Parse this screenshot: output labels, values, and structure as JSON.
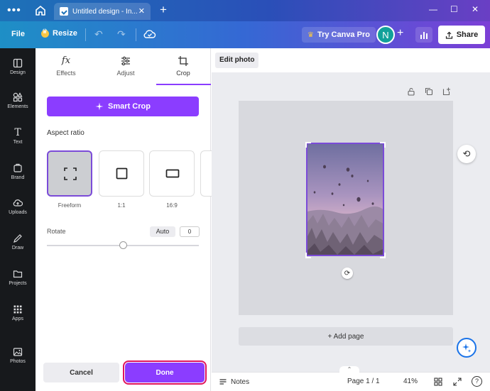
{
  "titlebar": {
    "tab_title": "Untitled design - In...",
    "menu_icon": "more-dots-icon",
    "home_icon": "home-icon",
    "new_tab_icon": "plus-icon"
  },
  "toolbar": {
    "file_label": "File",
    "resize_label": "Resize",
    "try_canva_label": "Try Canva Pro",
    "avatar_initial": "N",
    "share_label": "Share"
  },
  "rail": {
    "items": [
      {
        "label": "Design",
        "icon": "design-icon"
      },
      {
        "label": "Elements",
        "icon": "elements-icon"
      },
      {
        "label": "Text",
        "icon": "text-icon"
      },
      {
        "label": "Brand",
        "icon": "brand-icon"
      },
      {
        "label": "Uploads",
        "icon": "uploads-icon"
      },
      {
        "label": "Draw",
        "icon": "draw-icon"
      },
      {
        "label": "Projects",
        "icon": "projects-icon"
      },
      {
        "label": "Apps",
        "icon": "apps-icon"
      },
      {
        "label": "Photos",
        "icon": "photos-icon"
      }
    ]
  },
  "panel": {
    "tabs": [
      {
        "label": "Effects",
        "icon": "fx-icon"
      },
      {
        "label": "Adjust",
        "icon": "sliders-icon"
      },
      {
        "label": "Crop",
        "icon": "crop-icon"
      }
    ],
    "active_tab": "Crop",
    "smart_crop_label": "Smart Crop",
    "aspect_ratio_label": "Aspect ratio",
    "ratios": [
      {
        "label": "Freeform",
        "selected": true
      },
      {
        "label": "1:1",
        "selected": false
      },
      {
        "label": "16:9",
        "selected": false
      }
    ],
    "rotate_label": "Rotate",
    "auto_label": "Auto",
    "rotate_value": "0",
    "cancel_label": "Cancel",
    "done_label": "Done"
  },
  "canvas": {
    "edit_photo_label": "Edit photo",
    "add_page_label": "+ Add page"
  },
  "bottombar": {
    "notes_label": "Notes",
    "page_label": "Page 1 / 1",
    "zoom_label": "41%",
    "help_label": "?"
  },
  "colors": {
    "accent": "#8b3dff",
    "done_outline": "#e0145c",
    "rail_bg": "#17191c"
  }
}
